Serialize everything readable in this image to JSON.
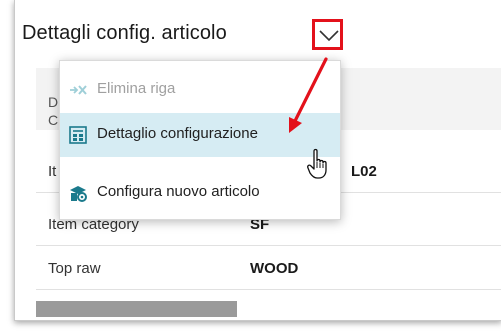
{
  "panel": {
    "title": "Dettagli config. articolo"
  },
  "rows": [
    {
      "label": "It",
      "value": "L02"
    },
    {
      "label": "Item category",
      "value": "SF"
    },
    {
      "label": "Top raw",
      "value": "WOOD"
    }
  ],
  "header_partial": {
    "line1": "D",
    "line2": "C"
  },
  "menu": {
    "items": [
      {
        "label": "Elimina riga",
        "icon": "delete-row-icon",
        "state": "disabled"
      },
      {
        "label": "Dettaglio configurazione",
        "icon": "configuration-detail-icon",
        "state": "highlighted"
      },
      {
        "label": "Configura nuovo articolo",
        "icon": "configure-new-item-icon",
        "state": "normal"
      }
    ]
  },
  "colors": {
    "highlight_border": "#e3111b",
    "menu_hover": "#d6ecf3",
    "icon_accent": "#1b7a8c"
  }
}
